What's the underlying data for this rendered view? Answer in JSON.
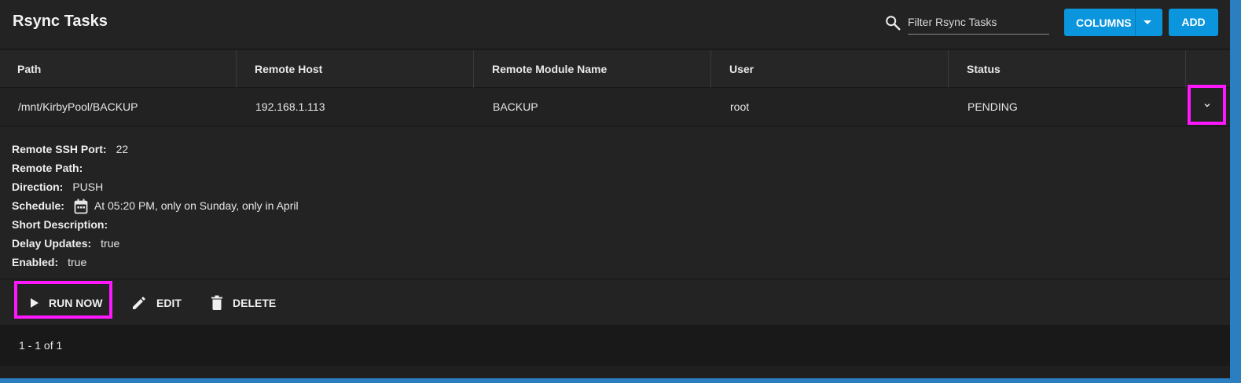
{
  "header": {
    "title": "Rsync Tasks",
    "search_placeholder": "Filter Rsync Tasks",
    "columns_label": "COLUMNS",
    "add_label": "ADD"
  },
  "table": {
    "columns": [
      "Path",
      "Remote Host",
      "Remote Module Name",
      "User",
      "Status"
    ],
    "rows": [
      {
        "path": "/mnt/KirbyPool/BACKUP",
        "remote_host": "192.168.1.113",
        "remote_module": "BACKUP",
        "user": "root",
        "status": "PENDING"
      }
    ]
  },
  "detail": {
    "ssh_port_label": "Remote SSH Port:",
    "ssh_port": "22",
    "remote_path_label": "Remote Path:",
    "remote_path": "",
    "direction_label": "Direction:",
    "direction": "PUSH",
    "schedule_label": "Schedule:",
    "schedule": "At 05:20 PM, only on Sunday, only in April",
    "short_desc_label": "Short Description:",
    "short_desc": "",
    "delay_label": "Delay Updates:",
    "delay": "true",
    "enabled_label": "Enabled:",
    "enabled": "true"
  },
  "actions": {
    "run_now": "RUN NOW",
    "edit": "EDIT",
    "delete": "DELETE"
  },
  "footer": {
    "pagination": "1 - 1 of 1"
  },
  "colors": {
    "accent": "#0a95dd",
    "highlight": "#ff18ff"
  }
}
